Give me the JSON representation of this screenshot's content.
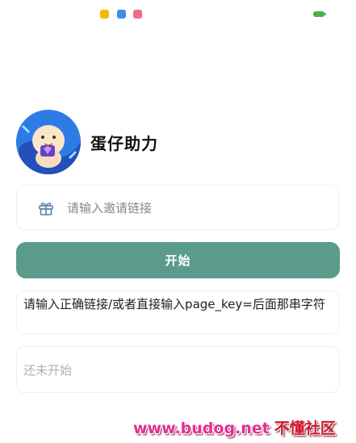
{
  "status_bar": {
    "notification_icons": [
      "app-notification-icon",
      "app-notification-icon",
      "app-notification-icon"
    ],
    "battery_color": "#49b34a"
  },
  "app": {
    "title": "蛋仔助力",
    "avatar_icon": "eggy-character-avatar"
  },
  "invite": {
    "icon": "gift-icon",
    "placeholder": "请输入邀请链接",
    "value": ""
  },
  "start_button": {
    "label": "开始",
    "color": "#5a9b8c"
  },
  "hint": {
    "text": "请输入正确链接/或者直接输入page_key=后面那串字符"
  },
  "status": {
    "text": "还未开始"
  },
  "watermark": {
    "url": "www.budog.net",
    "site": "不懂社区"
  }
}
